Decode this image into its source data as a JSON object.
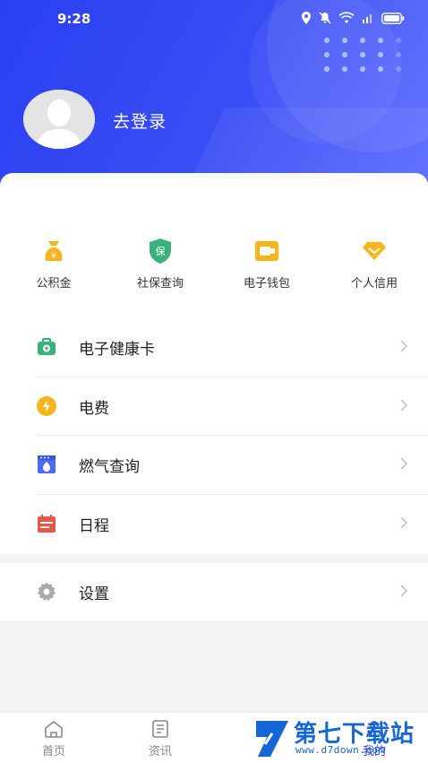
{
  "status_bar": {
    "time": "9:28"
  },
  "profile": {
    "login_label": "去登录"
  },
  "quick_actions": [
    {
      "label": "公积金",
      "icon": "money-bag-icon",
      "color": "#f5b51b"
    },
    {
      "label": "社保查询",
      "icon": "shield-icon",
      "color": "#3bb27a"
    },
    {
      "label": "电子钱包",
      "icon": "wallet-icon",
      "color": "#f5b51b"
    },
    {
      "label": "个人信用",
      "icon": "diamond-icon",
      "color": "#f5b51b"
    }
  ],
  "menu": [
    {
      "label": "电子健康卡",
      "icon": "medical-kit-icon",
      "color": "#3bb27a"
    },
    {
      "label": "电费",
      "icon": "lightning-icon",
      "color": "#f5b51b"
    },
    {
      "label": "燃气查询",
      "icon": "gas-stove-icon",
      "color": "#4a6cf0"
    },
    {
      "label": "日程",
      "icon": "calendar-icon",
      "color": "#e8574a"
    }
  ],
  "settings": {
    "label": "设置",
    "icon": "gear-icon"
  },
  "tabbar": [
    {
      "label": "首页",
      "icon": "home-icon"
    },
    {
      "label": "资讯",
      "icon": "news-icon"
    },
    {
      "label": "我的",
      "icon": "profile-icon"
    }
  ],
  "watermark": {
    "text": "第七下载站",
    "url": "www.d7down.com"
  },
  "colors": {
    "header": "#2a3ff0",
    "accent": "#1566d6"
  }
}
